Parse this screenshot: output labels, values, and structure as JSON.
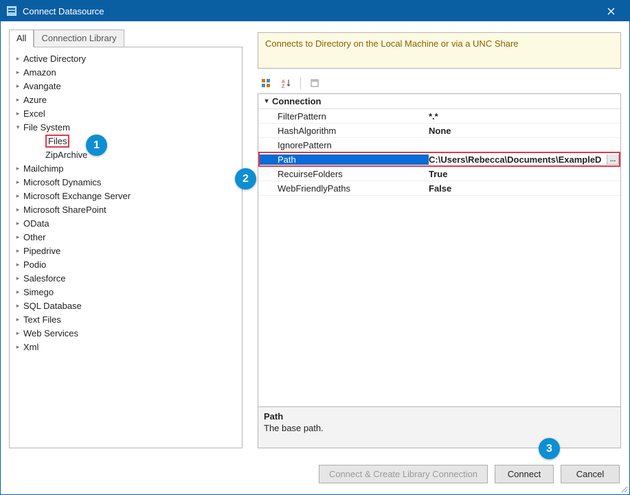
{
  "window": {
    "title": "Connect Datasource"
  },
  "tabs": {
    "all": "All",
    "library": "Connection Library"
  },
  "tree": {
    "items": [
      {
        "label": "Active Directory"
      },
      {
        "label": "Amazon"
      },
      {
        "label": "Avangate"
      },
      {
        "label": "Azure"
      },
      {
        "label": "Excel"
      },
      {
        "label": "File System",
        "expanded": true,
        "children": [
          {
            "label": "Files",
            "highlight": true
          },
          {
            "label": "ZipArchive"
          }
        ]
      },
      {
        "label": "Mailchimp"
      },
      {
        "label": "Microsoft Dynamics"
      },
      {
        "label": "Microsoft Exchange Server"
      },
      {
        "label": "Microsoft SharePoint"
      },
      {
        "label": "OData"
      },
      {
        "label": "Other"
      },
      {
        "label": "Pipedrive"
      },
      {
        "label": "Podio"
      },
      {
        "label": "Salesforce"
      },
      {
        "label": "Simego"
      },
      {
        "label": "SQL Database"
      },
      {
        "label": "Text Files"
      },
      {
        "label": "Web Services"
      },
      {
        "label": "Xml"
      }
    ]
  },
  "info": {
    "text": "Connects to Directory on the Local Machine or via a UNC Share"
  },
  "propgrid": {
    "category": "Connection",
    "rows": [
      {
        "name": "FilterPattern",
        "value": "*.*"
      },
      {
        "name": "HashAlgorithm",
        "value": "None"
      },
      {
        "name": "IgnorePattern",
        "value": ""
      },
      {
        "name": "Path",
        "value": "C:\\Users\\Rebecca\\Documents\\ExampleD",
        "selected": true
      },
      {
        "name": "RecuirseFolders",
        "value": "True"
      },
      {
        "name": "WebFriendlyPaths",
        "value": "False"
      }
    ]
  },
  "description": {
    "title": "Path",
    "text": "The base path."
  },
  "buttons": {
    "create_library": "Connect & Create Library Connection",
    "connect": "Connect",
    "cancel": "Cancel"
  },
  "callouts": {
    "c1": "1",
    "c2": "2",
    "c3": "3"
  }
}
